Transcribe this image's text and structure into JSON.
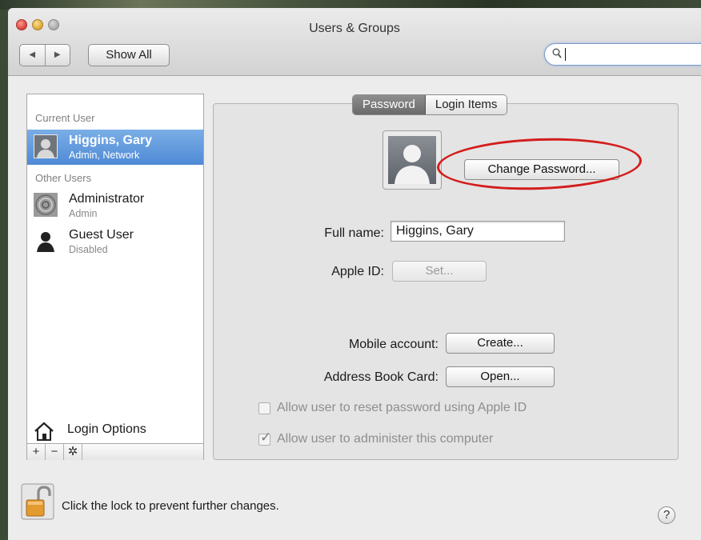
{
  "window": {
    "title": "Users & Groups"
  },
  "toolbar": {
    "back_label": "◀",
    "forward_label": "▶",
    "show_all_label": "Show All",
    "search_value": ""
  },
  "sidebar": {
    "current_user_header": "Current User",
    "current_user": {
      "name": "Higgins, Gary",
      "role": "Admin, Network"
    },
    "other_users_header": "Other Users",
    "other_users": [
      {
        "name": "Administrator",
        "role": "Admin"
      },
      {
        "name": "Guest User",
        "role": "Disabled"
      }
    ],
    "login_options_label": "Login Options",
    "add_label": "+",
    "remove_label": "−",
    "action_label": "✲"
  },
  "tabs": [
    {
      "label": "Password",
      "active": true
    },
    {
      "label": "Login Items",
      "active": false
    }
  ],
  "detail": {
    "change_password_label": "Change Password...",
    "full_name_label": "Full name:",
    "full_name_value": "Higgins, Gary",
    "apple_id_label": "Apple ID:",
    "apple_id_button": "Set...",
    "mobile_account_label": "Mobile account:",
    "mobile_account_button": "Create...",
    "address_book_label": "Address Book Card:",
    "address_book_button": "Open...",
    "allow_reset_label": "Allow user to reset password using Apple ID",
    "allow_reset_checked": false,
    "allow_admin_label": "Allow user to administer this computer",
    "allow_admin_checked": true
  },
  "footer": {
    "lock_text": "Click the lock to prevent further changes.",
    "help_label": "?"
  },
  "colors": {
    "selection": "#4f8ad6",
    "annotation": "#d41d1d"
  }
}
